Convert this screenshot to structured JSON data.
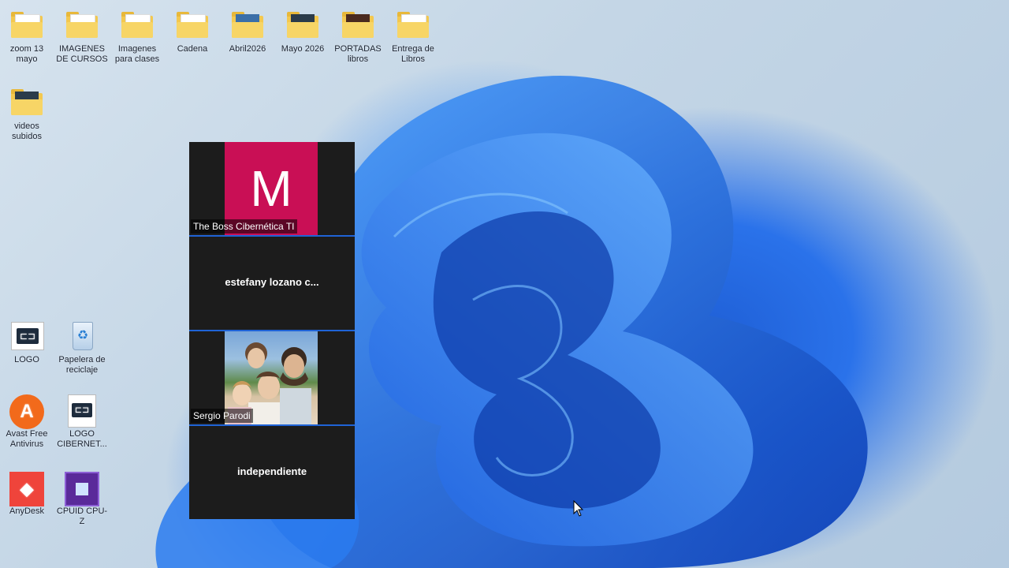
{
  "desktop": {
    "top_icons": [
      {
        "label": "zoom 13 mayo",
        "icon": "folder-icon"
      },
      {
        "label": "IMAGENES DE CURSOS",
        "icon": "folder-icon"
      },
      {
        "label": "Imagenes para clases",
        "icon": "folder-icon"
      },
      {
        "label": "Cadena",
        "icon": "folder-icon"
      },
      {
        "label": "Abril2026",
        "icon": "folder-icon"
      },
      {
        "label": "Mayo 2026",
        "icon": "folder-icon"
      },
      {
        "label": "PORTADAS libros",
        "icon": "folder-icon"
      },
      {
        "label": "Entrega de Libros",
        "icon": "folder-icon"
      }
    ],
    "second_row": [
      {
        "label": "videos subidos",
        "icon": "folder-icon"
      }
    ],
    "bottom_icons": [
      {
        "label": "LOGO",
        "icon": "logo-icon"
      },
      {
        "label": "Papelera de reciclaje",
        "icon": "recycle-bin-icon"
      },
      {
        "label": "Avast Free Antivirus",
        "icon": "avast-icon"
      },
      {
        "label": "LOGO CIBERNET...",
        "icon": "logo-icon"
      },
      {
        "label": "AnyDesk",
        "icon": "anydesk-icon"
      },
      {
        "label": "CPUID CPU-Z",
        "icon": "cpuz-icon"
      }
    ]
  },
  "zoom_panel": {
    "participants": [
      {
        "name": "The Boss Cibernética TI",
        "avatar_letter": "M",
        "avatar_color": "#c90f55"
      },
      {
        "name": "estefany lozano c..."
      },
      {
        "name": "Sergio Parodi"
      },
      {
        "name": "independiente"
      }
    ]
  }
}
